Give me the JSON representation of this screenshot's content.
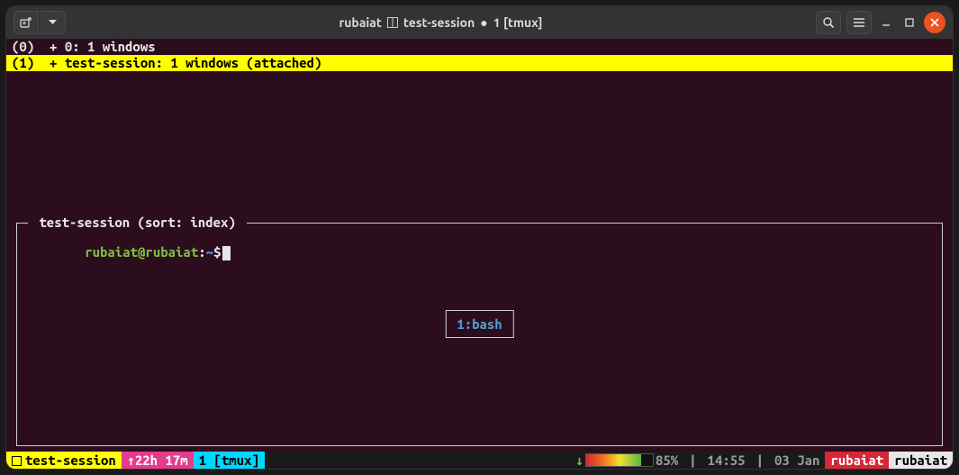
{
  "titlebar": {
    "title_user": "rubaiat",
    "title_session": "test-session",
    "title_window": "1 [tmux]"
  },
  "session_list": [
    {
      "index": "(0)",
      "text": "+ 0: 1 windows",
      "selected": false
    },
    {
      "index": "(1)",
      "text": "+ test-session: 1 windows (attached)",
      "selected": true
    }
  ],
  "preview": {
    "title": "test-session (sort: index)",
    "prompt_user": "rubaiat",
    "prompt_host": "rubaiat",
    "prompt_path": "~",
    "prompt_symbol": "$",
    "window_label": "1:bash"
  },
  "statusbar": {
    "left_session": "test-session",
    "uptime": "22h 17m",
    "window": "1 [tmux]",
    "arrow_up": "↑",
    "arrow_down": "↓",
    "battery_pct": "85%",
    "time": "14:55",
    "date": "03 Jan",
    "host1": "rubaiat",
    "host2": "rubaiat",
    "sep": "|"
  }
}
